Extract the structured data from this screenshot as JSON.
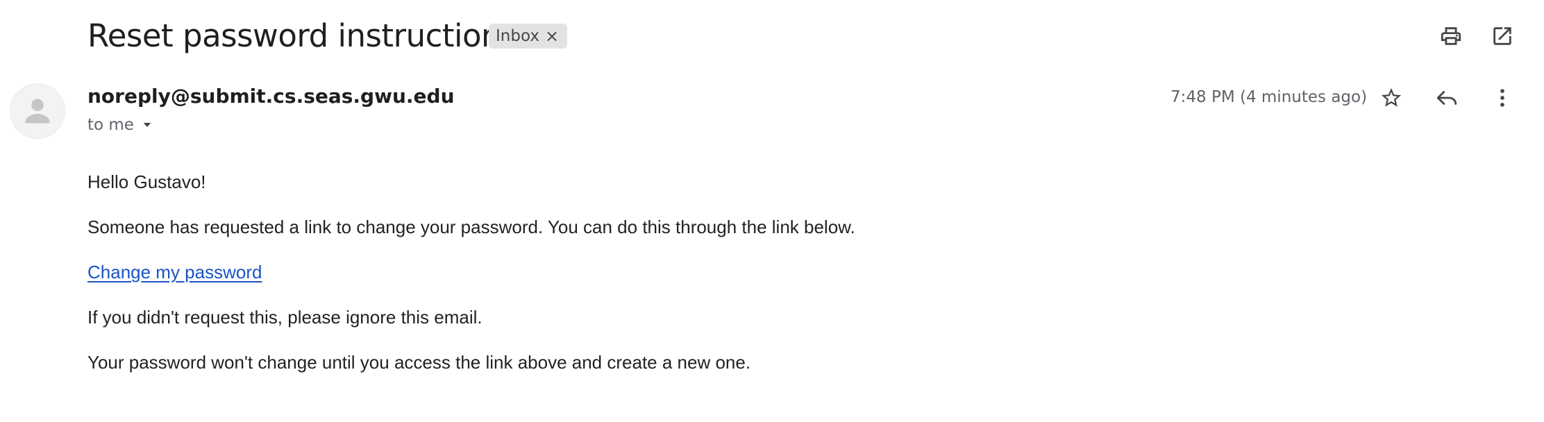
{
  "email": {
    "subject": "Reset password instructions",
    "label_chip": {
      "text": "Inbox",
      "remove_glyph": "×"
    },
    "sender": "noreply@submit.cs.seas.gwu.edu",
    "recipient": "to me",
    "timestamp": "7:48 PM (4 minutes ago)",
    "body": {
      "greeting": "Hello Gustavo!",
      "paragraph_1": "Someone has requested a link to change your password. You can do this through the link below.",
      "link_text": "Change my password",
      "paragraph_2": "If you didn't request this, please ignore this email.",
      "paragraph_3": "Your password won't change until you access the link above and create a new one."
    }
  },
  "icons": {
    "header": [
      "printer-icon",
      "open-in-new-window-icon"
    ],
    "message_actions": [
      "star-icon",
      "reply-icon",
      "more-vert-icon"
    ],
    "avatar": "person-icon",
    "recipient_toggle": "caret-down-icon"
  },
  "colors": {
    "text_primary": "#1f1f1f",
    "text_secondary": "#5f6368",
    "link": "#1a53c4",
    "chip_bg": "#e3e3e3",
    "avatar_bg": "#f1f3f4",
    "avatar_glyph": "#c4c7c5"
  }
}
